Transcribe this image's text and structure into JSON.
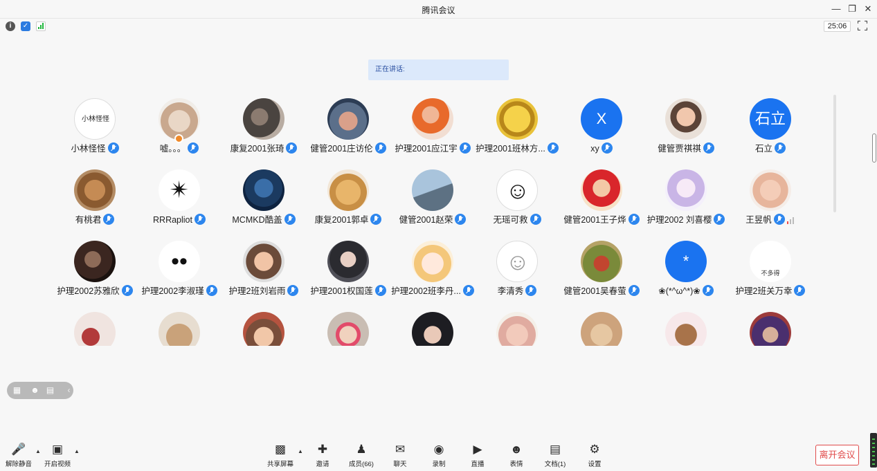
{
  "window": {
    "title": "腾讯会议"
  },
  "topbar": {
    "timer": "25:06"
  },
  "speaking": {
    "label": "正在讲话:"
  },
  "participants": [
    {
      "name": "小林怪怪",
      "avatar": "text-logo",
      "avatar_text": "小林怪怪"
    },
    {
      "name": "嘘。。。",
      "avatar": "cat-photo",
      "host": true
    },
    {
      "name": "康复2001张琦",
      "avatar": "photo-girl"
    },
    {
      "name": "健管2001庄访伦",
      "avatar": "photo-man"
    },
    {
      "name": "护理2001应江宇",
      "avatar": "photo-orange"
    },
    {
      "name": "护理2001班林方...",
      "avatar": "gold-coin"
    },
    {
      "name": "xy",
      "avatar": "letter",
      "letter": "X",
      "color": "#1a73f0"
    },
    {
      "name": "健管贾祺祺",
      "avatar": "photo-child"
    },
    {
      "name": "石立",
      "avatar": "letter",
      "letter": "石立",
      "color": "#1a73f0"
    },
    {
      "name": "有桃君",
      "avatar": "photo-cat"
    },
    {
      "name": "RRRapliot",
      "avatar": "spider"
    },
    {
      "name": "MCMKD酷盖",
      "avatar": "photo-blue"
    },
    {
      "name": "康复2001郭卓",
      "avatar": "photo-dog"
    },
    {
      "name": "健管2001赵荣",
      "avatar": "photo-plane"
    },
    {
      "name": "无瑶可救",
      "avatar": "smiley"
    },
    {
      "name": "健管2001王子烨",
      "avatar": "photo-red"
    },
    {
      "name": "护理2002 刘喜樱",
      "avatar": "photo-anime"
    },
    {
      "name": "王昱帆",
      "avatar": "photo-baby",
      "signal": true
    },
    {
      "name": "护理2002苏雅欣",
      "avatar": "photo-dark"
    },
    {
      "name": "护理2002李淑瑾",
      "avatar": "snoopy"
    },
    {
      "name": "护理2班刘岩雨",
      "avatar": "photo-kid"
    },
    {
      "name": "护理2001权国莲",
      "avatar": "photo-woman"
    },
    {
      "name": "护理2002班李丹...",
      "avatar": "anime-girl"
    },
    {
      "name": "李清秀",
      "avatar": "doodle"
    },
    {
      "name": "健管2001吴春萤",
      "avatar": "photo-monkey"
    },
    {
      "name": "❀(*^ω^*)❀",
      "avatar": "letter",
      "letter": "*",
      "color": "#1a73f0"
    },
    {
      "name": "护理2班关万幸",
      "avatar": "emoji",
      "avatar_text": "不多得"
    },
    {
      "name": "",
      "avatar": "photo-r4-1"
    },
    {
      "name": "",
      "avatar": "photo-r4-2"
    },
    {
      "name": "",
      "avatar": "photo-r4-3"
    },
    {
      "name": "",
      "avatar": "photo-r4-4"
    },
    {
      "name": "",
      "avatar": "photo-r4-5"
    },
    {
      "name": "",
      "avatar": "photo-r4-6"
    },
    {
      "name": "",
      "avatar": "photo-r4-7"
    },
    {
      "name": "",
      "avatar": "bear"
    },
    {
      "name": "",
      "avatar": "photo-r4-9"
    }
  ],
  "toolbar": {
    "unmute": "解除静音",
    "start_video": "开启视频",
    "share_screen": "共享屏幕",
    "invite": "邀请",
    "members": "成员(66)",
    "chat": "聊天",
    "record": "录制",
    "live": "直播",
    "emoji": "表情",
    "docs": "文档(1)",
    "settings": "设置",
    "leave": "离开会议"
  },
  "colors": {
    "accent": "#2d86ee",
    "leave": "#e04b4b",
    "speaking_bg": "#dce9fb"
  }
}
